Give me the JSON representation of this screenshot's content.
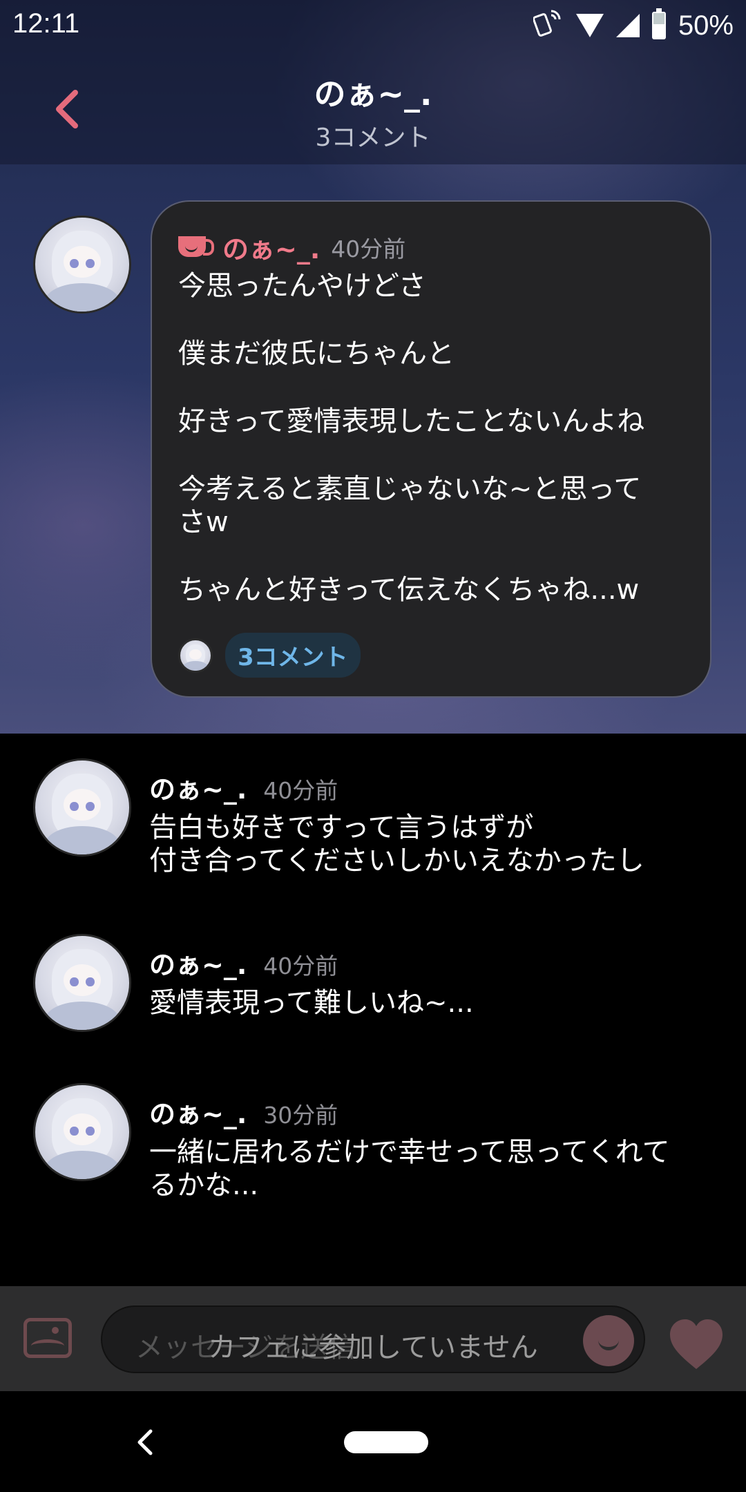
{
  "status_bar": {
    "time": "12:11",
    "battery": "50%"
  },
  "header": {
    "title": "のぁ~_.",
    "subtitle": "3コメント"
  },
  "post": {
    "author": "のぁ~_.",
    "time": "40分前",
    "paragraphs": [
      "今思ったんやけどさ",
      "僕まだ彼氏にちゃんと",
      "好きって愛情表現したことないんよね",
      "今考えると素直じゃないな~と思って\nさw",
      "ちゃんと好きって伝えなくちゃね...w"
    ],
    "comment_chip": "3コメント"
  },
  "comments": [
    {
      "author": "のぁ~_.",
      "time": "40分前",
      "text": "告白も好きですって言うはずが\n付き合ってくださいしかいえなかったし"
    },
    {
      "author": "のぁ~_.",
      "time": "40分前",
      "text": "愛情表現って難しいね~..."
    },
    {
      "author": "のぁ~_.",
      "time": "30分前",
      "text": "一緒に居れるだけで幸せって思ってくれて\nるかな..."
    }
  ],
  "input_bar": {
    "placeholder": "メッセージを送信",
    "notice": "カフェに参加していません"
  },
  "colors": {
    "accent_pink": "#f07a8a",
    "chip_blue": "#6fb6e8",
    "bubble_bg": "#232325"
  },
  "icons": {
    "back": "chevron-left-icon",
    "cup": "coffee-cup-icon",
    "image": "image-icon",
    "emoji": "emoji-icon",
    "heart": "heart-icon"
  }
}
